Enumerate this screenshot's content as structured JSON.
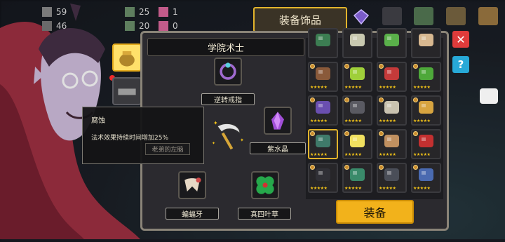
{
  "hud": {
    "row1": {
      "a": "59",
      "b": "25",
      "c": "1"
    },
    "row2": {
      "a": "46",
      "b": "20",
      "c": "0"
    }
  },
  "tab_title": "装备饰品",
  "character_name": "学院术士",
  "slots": {
    "top": {
      "label": "逆转戒指",
      "icon": "ring-icon"
    },
    "right": {
      "label": "紫水晶",
      "icon": "amethyst-icon"
    },
    "bottom_left": {
      "label": "蝙蝠牙",
      "icon": "bat-fang-icon"
    },
    "bottom_right": {
      "label": "真四叶草",
      "icon": "clover-icon"
    },
    "center": {
      "icon": "scythe-weapon-icon"
    }
  },
  "tooltip": {
    "title": "腐蚀",
    "description": "法术效果持续时间增加25%",
    "faded_label": "老弟的左脑"
  },
  "grid_stars": "★★★★★",
  "grid_items": [
    {
      "icon": "green-mushroom-icon",
      "stars": false
    },
    {
      "icon": "fish-skeleton-icon",
      "stars": false
    },
    {
      "icon": "green-potion-bottle-icon",
      "stars": false
    },
    {
      "icon": "skull-head-icon",
      "stars": false
    },
    {
      "icon": "boot-icon",
      "stars": true
    },
    {
      "icon": "poison-bottle-icon",
      "stars": true
    },
    {
      "icon": "shield-icon",
      "stars": true
    },
    {
      "icon": "green-book-icon",
      "stars": true
    },
    {
      "icon": "purple-gem-icon",
      "stars": true
    },
    {
      "icon": "anvil-icon",
      "stars": true
    },
    {
      "icon": "glyph-scroll-icon",
      "stars": true
    },
    {
      "icon": "treasure-chest-icon",
      "stars": true
    },
    {
      "icon": "claw-icon",
      "stars": true,
      "selected": true
    },
    {
      "icon": "yellow-orb-icon",
      "stars": true
    },
    {
      "icon": "gauntlet-icon",
      "stars": true
    },
    {
      "icon": "red-figure-icon",
      "stars": true
    },
    {
      "icon": "dark-serpent-icon",
      "stars": true
    },
    {
      "icon": "green-snake-icon",
      "stars": true
    },
    {
      "icon": "dark-spiked-ball-icon",
      "stars": true
    },
    {
      "icon": "blue-armor-icon",
      "stars": true
    }
  ],
  "equip_button": "装备",
  "colors": {
    "accent": "#e2b42c",
    "button": "#f2b21b",
    "panel": "#2b2a2f"
  }
}
